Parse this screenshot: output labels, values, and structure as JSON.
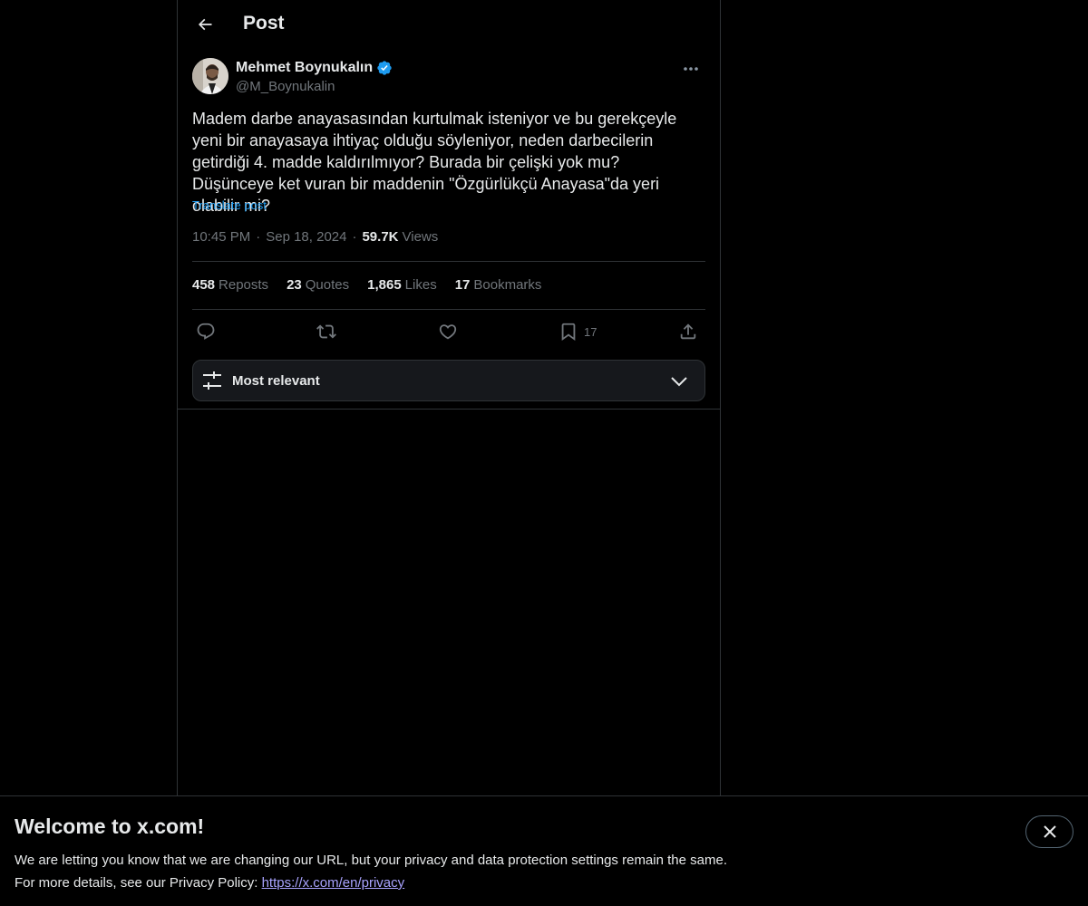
{
  "header": {
    "title": "Post"
  },
  "author": {
    "name": "Mehmet Boynukalın",
    "handle": "@M_Boynukalin",
    "verified": true,
    "verified_color": "#1d9bf0"
  },
  "post": {
    "text": "Madem darbe anayasasından kurtulmak isteniyor ve bu gerekçeyle yeni bir anayasaya ihtiyaç olduğu söyleniyor, neden darbecilerin getirdiği 4. madde kaldırılmıyor? Burada bir çelişki yok mu? Düşünceye ket vuran bir maddenin \"Özgürlükçü Anayasa\"da yeri olabilir mi?",
    "translate_label": "Translate post",
    "time": "10:45 PM",
    "date": "Sep 18, 2024",
    "views_count": "59.7K",
    "views_label": "Views"
  },
  "stats": {
    "reposts_count": "458",
    "reposts_label": "Reposts",
    "quotes_count": "23",
    "quotes_label": "Quotes",
    "likes_count": "1,865",
    "likes_label": "Likes",
    "bookmarks_count": "17",
    "bookmarks_label": "Bookmarks"
  },
  "actions": {
    "reply_icon": "reply-icon",
    "repost_icon": "repost-icon",
    "like_icon": "heart-icon",
    "bookmark_icon": "bookmark-icon",
    "bookmark_count": "17",
    "share_icon": "share-icon"
  },
  "sort": {
    "label": "Most relevant"
  },
  "banner": {
    "title": "Welcome to x.com!",
    "line1": "We are letting you know that we are changing our URL, but your privacy and data protection settings remain the same.",
    "line2_prefix": "For more details, see our Privacy Policy: ",
    "link": "https://x.com/en/privacy"
  },
  "colors": {
    "background": "#000000",
    "text": "#e7e9ea",
    "muted": "#71767b",
    "accent": "#1d9bf0",
    "border": "#2f3336"
  }
}
